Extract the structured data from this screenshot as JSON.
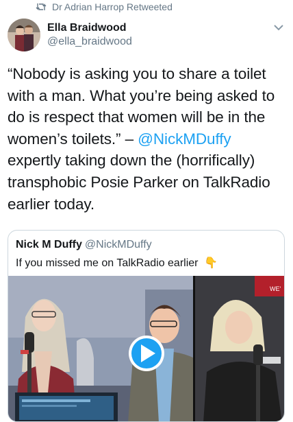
{
  "retweet": {
    "text": "Dr Adrian Harrop Retweeted",
    "icon": "retweet-icon"
  },
  "author": {
    "name": "Ella Braidwood",
    "handle": "@ella_braidwood"
  },
  "tweet": {
    "part1": "“Nobody is asking you to share a toilet with a man. What you’re being asked to do is respect that women will be in the women’s toilets.” – ",
    "mention": "@NickMDuffy",
    "part2": " expertly taking down the (horrifically) transphobic Posie Parker on TalkRadio earlier today."
  },
  "quoted": {
    "name": "Nick M Duffy",
    "handle": "@NickMDuffy",
    "text": "If you missed me on TalkRadio earlier",
    "emoji": "👇",
    "media_sign": "WE'"
  },
  "colors": {
    "link": "#1da1f2",
    "secondary": "#657786",
    "border": "#ccd6dd"
  }
}
